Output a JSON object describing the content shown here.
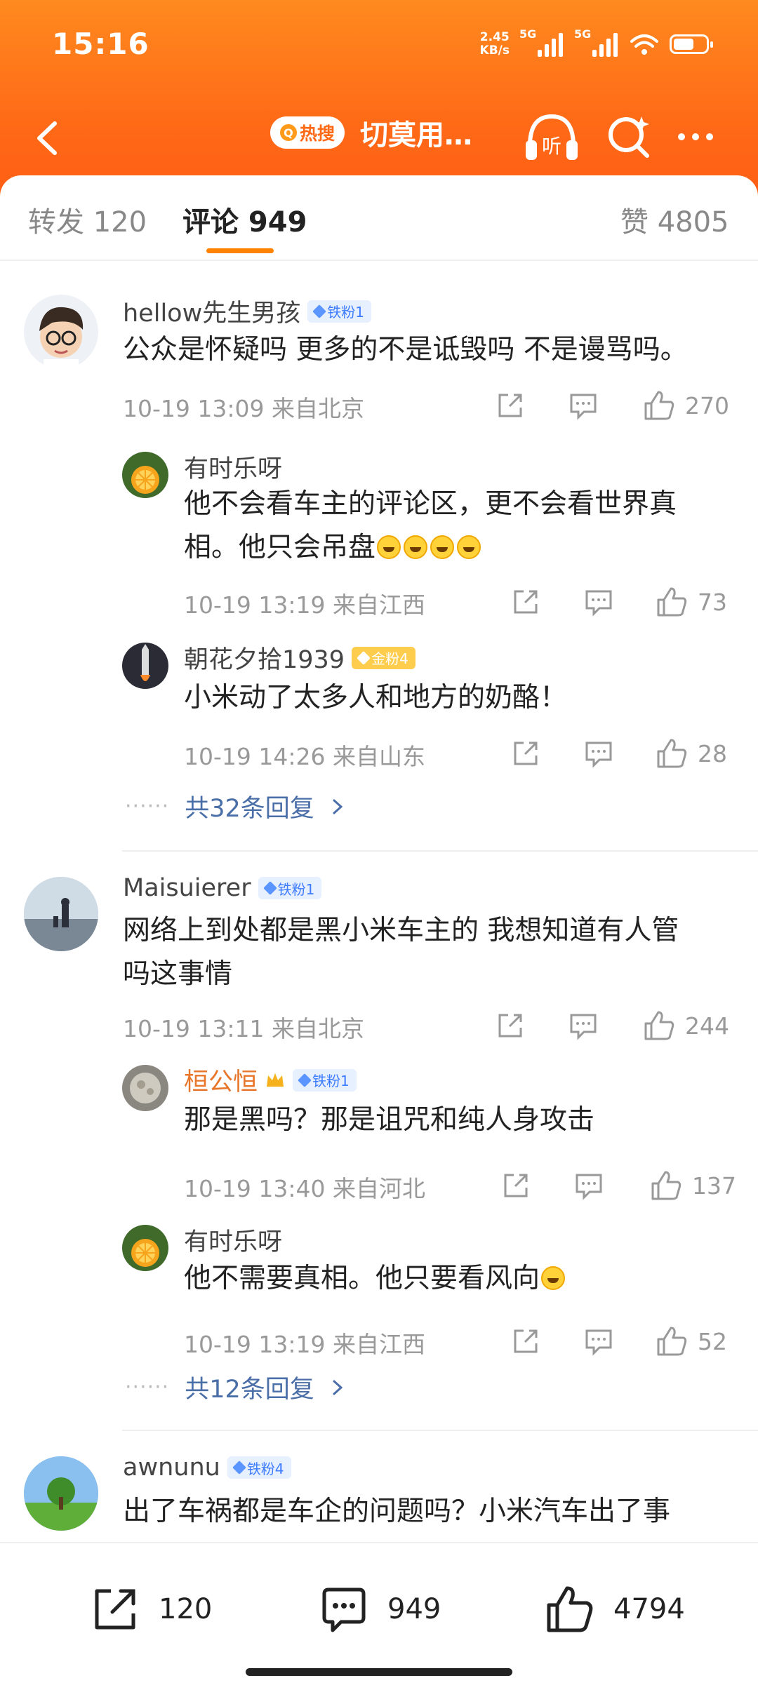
{
  "status": {
    "time": "15:16",
    "speed_top": "2.45",
    "speed_bottom": "KB/s",
    "net1": "5G",
    "net2": "5G"
  },
  "header": {
    "hot_label": "热搜",
    "title": "切莫用…"
  },
  "tabs": [
    {
      "label": "转发 120"
    },
    {
      "label": "评论 949"
    },
    {
      "label": "赞 4805"
    }
  ],
  "comments": [
    {
      "user": "hellow先生男孩",
      "badge": "铁粉1",
      "text": "公众是怀疑吗 更多的不是诋毁吗 不是谩骂吗。",
      "meta": "10-19 13:09 来自北京",
      "likes": "270",
      "replies": [
        {
          "user": "有时乐呀",
          "text_line1": "他不会看车主的评论区，更不会看世界真",
          "text_line2": "相。他只会吊盘",
          "meta": "10-19 13:19 来自江西",
          "likes": "73"
        },
        {
          "user": "朝花夕拾1939",
          "badge": "金粉4",
          "text": "小米动了太多人和地方的奶酪！",
          "meta": "10-19 14:26 来自山东",
          "likes": "28"
        }
      ],
      "more": "共32条回复"
    },
    {
      "user": "Maisuierer",
      "badge": "铁粉1",
      "text_line1": "网络上到处都是黑小米车主的 我想知道有人管",
      "text_line2": "吗这事情",
      "meta": "10-19 13:11 来自北京",
      "likes": "244",
      "replies": [
        {
          "user": "桓公恒",
          "badge": "铁粉1",
          "text": "那是黑吗？那是诅咒和纯人身攻击",
          "meta": "10-19 13:40 来自河北",
          "likes": "137"
        },
        {
          "user": "有时乐呀",
          "text": "他不需要真相。他只要看风向",
          "meta": "10-19 13:19 来自江西",
          "likes": "52"
        }
      ],
      "more": "共12条回复"
    },
    {
      "user": "awnunu",
      "badge": "铁粉4",
      "text": "出了车祸都是车企的问题吗？小米汽车出了事"
    }
  ],
  "bottom": {
    "reposts": "120",
    "comments": "949",
    "likes": "4794"
  },
  "colors": {
    "header": "#ff6a17",
    "accent": "#ff8200",
    "link": "#4a6fa8"
  }
}
